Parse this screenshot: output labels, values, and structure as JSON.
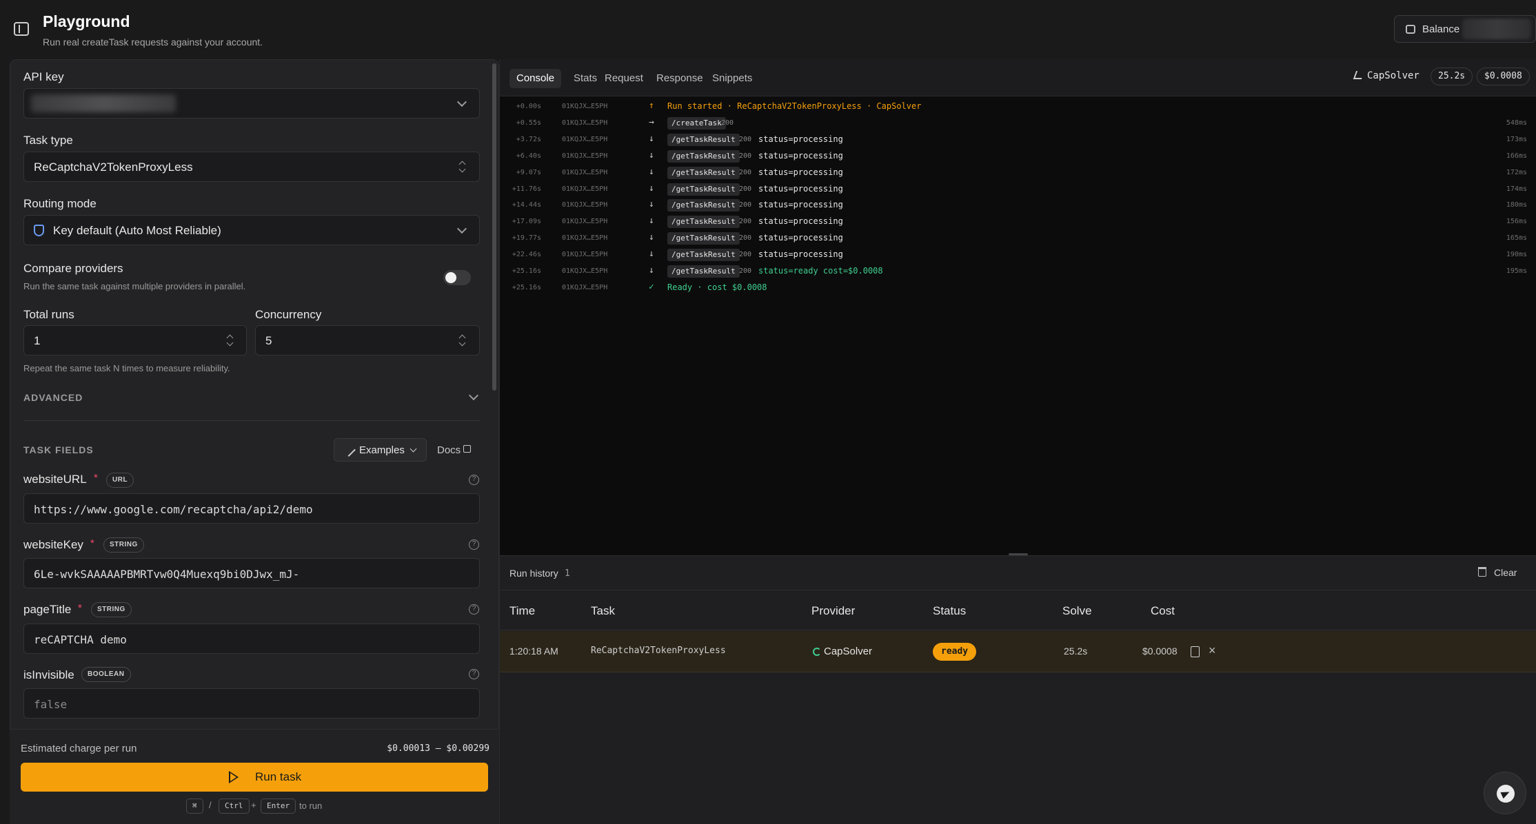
{
  "header": {
    "title": "Playground",
    "subtitle": "Run real createTask requests against your account.",
    "balance_label": "Balance"
  },
  "form": {
    "api_key_label": "API key",
    "task_type_label": "Task type",
    "task_type_value": "ReCaptchaV2TokenProxyLess",
    "routing_label": "Routing mode",
    "routing_value": "Key default (Auto Most Reliable)",
    "compare_label": "Compare providers",
    "compare_hint": "Run the same task against multiple providers in parallel.",
    "compare_enabled": false,
    "total_runs_label": "Total runs",
    "total_runs_value": "1",
    "concurrency_label": "Concurrency",
    "concurrency_value": "5",
    "runs_hint": "Repeat the same task N times to measure reliability.",
    "advanced_label": "ADVANCED",
    "task_fields_label": "TASK FIELDS",
    "examples_label": "Examples",
    "docs_label": "Docs",
    "required_mark": "*",
    "fields": [
      {
        "name": "websiteURL",
        "type": "URL",
        "value": "https://www.google.com/recaptcha/api2/demo"
      },
      {
        "name": "websiteKey",
        "type": "STRING",
        "value": "6Le-wvkSAAAAAPBMRTvw0Q4Muexq9bi0DJwx_mJ-"
      },
      {
        "name": "pageTitle",
        "type": "STRING",
        "value": "reCAPTCHA demo"
      },
      {
        "name": "isInvisible",
        "type": "BOOLEAN",
        "placeholder": "false"
      }
    ]
  },
  "footer": {
    "estimate_label": "Estimated charge per run",
    "estimate_value": "$0.00013 – $0.00299",
    "run_label": "Run task",
    "shortcut": {
      "cmd": "⌘",
      "slash": "/",
      "ctrl": "Ctrl",
      "plus": "+",
      "enter": "Enter",
      "suffix": "to run"
    }
  },
  "tabs": [
    "Console",
    "Stats",
    "Request",
    "Response",
    "Snippets"
  ],
  "active_tab": "Console",
  "summary": {
    "provider": "CapSolver",
    "duration": "25.2s",
    "cost": "$0.0008"
  },
  "console": {
    "lines": [
      {
        "t": "+0.00s",
        "id": "01KQJX…E5PH",
        "arrow": "↑",
        "kind": "start",
        "text": "Run started · ReCaptchaV2TokenProxyLess · CapSolver"
      },
      {
        "t": "+0.55s",
        "id": "01KQJX…E5PH",
        "arrow": "→",
        "kind": "req",
        "endpoint": "/createTask",
        "code": "200",
        "status": "",
        "ms": "548ms"
      },
      {
        "t": "+3.72s",
        "id": "01KQJX…E5PH",
        "arrow": "↓",
        "kind": "req",
        "endpoint": "/getTaskResult",
        "code": "200",
        "status": "status=processing",
        "ms": "173ms"
      },
      {
        "t": "+6.40s",
        "id": "01KQJX…E5PH",
        "arrow": "↓",
        "kind": "req",
        "endpoint": "/getTaskResult",
        "code": "200",
        "status": "status=processing",
        "ms": "166ms"
      },
      {
        "t": "+9.07s",
        "id": "01KQJX…E5PH",
        "arrow": "↓",
        "kind": "req",
        "endpoint": "/getTaskResult",
        "code": "200",
        "status": "status=processing",
        "ms": "172ms"
      },
      {
        "t": "+11.76s",
        "id": "01KQJX…E5PH",
        "arrow": "↓",
        "kind": "req",
        "endpoint": "/getTaskResult",
        "code": "200",
        "status": "status=processing",
        "ms": "174ms"
      },
      {
        "t": "+14.44s",
        "id": "01KQJX…E5PH",
        "arrow": "↓",
        "kind": "req",
        "endpoint": "/getTaskResult",
        "code": "200",
        "status": "status=processing",
        "ms": "180ms"
      },
      {
        "t": "+17.09s",
        "id": "01KQJX…E5PH",
        "arrow": "↓",
        "kind": "req",
        "endpoint": "/getTaskResult",
        "code": "200",
        "status": "status=processing",
        "ms": "156ms"
      },
      {
        "t": "+19.77s",
        "id": "01KQJX…E5PH",
        "arrow": "↓",
        "kind": "req",
        "endpoint": "/getTaskResult",
        "code": "200",
        "status": "status=processing",
        "ms": "165ms"
      },
      {
        "t": "+22.46s",
        "id": "01KQJX…E5PH",
        "arrow": "↓",
        "kind": "req",
        "endpoint": "/getTaskResult",
        "code": "200",
        "status": "status=processing",
        "ms": "190ms"
      },
      {
        "t": "+25.16s",
        "id": "01KQJX…E5PH",
        "arrow": "↓",
        "kind": "req-ok",
        "endpoint": "/getTaskResult",
        "code": "200",
        "status": "status=ready cost=$0.0008",
        "ms": "195ms"
      },
      {
        "t": "+25.16s",
        "id": "01KQJX…E5PH",
        "arrow": "✓",
        "kind": "done",
        "text": "Ready · cost $0.0008"
      }
    ]
  },
  "history": {
    "title": "Run history",
    "count": "1",
    "clear_label": "Clear",
    "columns": [
      "Time",
      "Task",
      "Provider",
      "Status",
      "Solve",
      "Cost"
    ],
    "rows": [
      {
        "time": "1:20:18 AM",
        "task": "ReCaptchaV2TokenProxyLess",
        "provider": "CapSolver",
        "status": "ready",
        "solve": "25.2s",
        "cost": "$0.0008"
      }
    ]
  },
  "colors": {
    "accent": "#f5a00b",
    "success": "#3fcf8e",
    "required": "#f2486b"
  },
  "icons": [
    "sidebar-toggle-icon",
    "wallet-icon",
    "chevron-down-icon",
    "shield-icon",
    "wand-icon",
    "external-link-icon",
    "help-icon",
    "play-icon",
    "activity-icon",
    "trash-icon",
    "document-icon",
    "close-icon",
    "send-icon"
  ]
}
